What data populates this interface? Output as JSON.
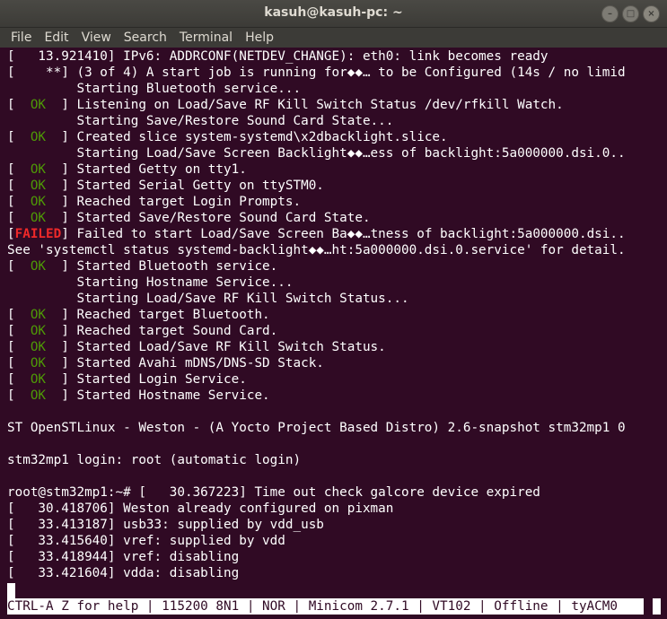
{
  "window": {
    "title": "kasuh@kasuh-pc: ~",
    "minimize_icon": "–",
    "maximize_icon": "□",
    "close_icon": "×"
  },
  "menu": [
    "File",
    "Edit",
    "View",
    "Search",
    "Terminal",
    "Help"
  ],
  "terminal": {
    "colors": {
      "background": "#300a24",
      "ok": "#4e9a06",
      "failed": "#ef2929",
      "text": "#ffffff"
    },
    "lines": [
      {
        "pre": "[   13.921410] IPv6: ADDRCONF(NETDEV_CHANGE): eth0: link becomes ready"
      },
      {
        "pre": "[    **] (3 of 4) A start job is running for◆◆… to be Configured (14s / no limid"
      },
      {
        "pre": "         Starting Bluetooth service..."
      },
      {
        "pre": "[ ",
        "ok": " OK ",
        "post": " ] Listening on Load/Save RF Kill Switch Status /dev/rfkill Watch."
      },
      {
        "pre": "         Starting Save/Restore Sound Card State..."
      },
      {
        "pre": "[ ",
        "ok": " OK ",
        "post": " ] Created slice system-systemd\\x2dbacklight.slice."
      },
      {
        "pre": "         Starting Load/Save Screen Backlight◆◆…ess of backlight:5a000000.dsi.0.."
      },
      {
        "pre": "[ ",
        "ok": " OK ",
        "post": " ] Started Getty on tty1."
      },
      {
        "pre": "[ ",
        "ok": " OK ",
        "post": " ] Started Serial Getty on ttySTM0."
      },
      {
        "pre": "[ ",
        "ok": " OK ",
        "post": " ] Reached target Login Prompts."
      },
      {
        "pre": "[ ",
        "ok": " OK ",
        "post": " ] Started Save/Restore Sound Card State."
      },
      {
        "pre": "[",
        "failed": "FAILED",
        "post": "] Failed to start Load/Save Screen Ba◆◆…tness of backlight:5a000000.dsi.."
      },
      {
        "pre": "See 'systemctl status systemd-backlight◆◆…ht:5a000000.dsi.0.service' for detail."
      },
      {
        "pre": "[ ",
        "ok": " OK ",
        "post": " ] Started Bluetooth service."
      },
      {
        "pre": "         Starting Hostname Service..."
      },
      {
        "pre": "         Starting Load/Save RF Kill Switch Status..."
      },
      {
        "pre": "[ ",
        "ok": " OK ",
        "post": " ] Reached target Bluetooth."
      },
      {
        "pre": "[ ",
        "ok": " OK ",
        "post": " ] Reached target Sound Card."
      },
      {
        "pre": "[ ",
        "ok": " OK ",
        "post": " ] Started Load/Save RF Kill Switch Status."
      },
      {
        "pre": "[ ",
        "ok": " OK ",
        "post": " ] Started Avahi mDNS/DNS-SD Stack."
      },
      {
        "pre": "[ ",
        "ok": " OK ",
        "post": " ] Started Login Service."
      },
      {
        "pre": "[ ",
        "ok": " OK ",
        "post": " ] Started Hostname Service."
      },
      {
        "pre": ""
      },
      {
        "pre": "ST OpenSTLinux - Weston - (A Yocto Project Based Distro) 2.6-snapshot stm32mp1 0"
      },
      {
        "pre": ""
      },
      {
        "pre": "stm32mp1 login: root (automatic login)"
      },
      {
        "pre": ""
      },
      {
        "pre": "root@stm32mp1:~# [   30.367223] Time out check galcore device expired"
      },
      {
        "pre": "[   30.418706] Weston already configured on pixman"
      },
      {
        "pre": "[   33.413187] usb33: supplied by vdd_usb"
      },
      {
        "pre": "[   33.415640] vref: supplied by vdd"
      },
      {
        "pre": "[   33.418944] vref: disabling"
      },
      {
        "pre": "[   33.421604] vdda: disabling"
      }
    ]
  },
  "status_bar": "CTRL-A Z for help | 115200 8N1 | NOR | Minicom 2.7.1 | VT102 | Offline | tyACM0"
}
